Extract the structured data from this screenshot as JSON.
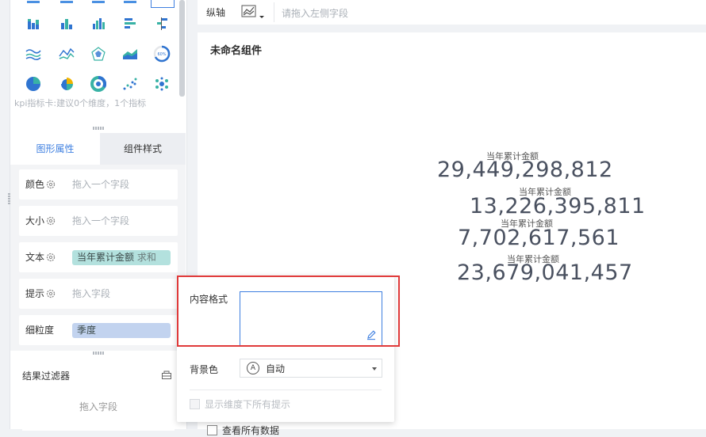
{
  "left_panel": {
    "kpi_hint": "kpi指标卡:建议0个维度，1个指标",
    "tabs": [
      {
        "label": "图形属性",
        "active": true
      },
      {
        "label": "组件样式",
        "active": false
      }
    ],
    "attributes": [
      {
        "label": "颜色",
        "placeholder": "拖入一个字段"
      },
      {
        "label": "大小",
        "placeholder": "拖入一个字段"
      },
      {
        "label": "文本",
        "field": "当年累计金额",
        "agg": "求和",
        "pill_color": "#b3e1de"
      },
      {
        "label": "提示",
        "placeholder": "拖入字段"
      },
      {
        "label": "细粒度",
        "field": "季度",
        "pill_color": "#c2d3ef"
      }
    ],
    "filter": {
      "title": "结果过滤器",
      "placeholder": "拖入字段"
    }
  },
  "topbar": {
    "y_axis_label": "纵轴",
    "y_axis_placeholder": "请拖入左侧字段"
  },
  "canvas": {
    "title": "未命名组件",
    "kpis": [
      {
        "caption": "当年累计金额",
        "value": "29,449,298,812"
      },
      {
        "caption": "当年累计金额",
        "value": "13,226,395,811"
      },
      {
        "caption": "当年累计金额",
        "value": "7,702,617,561"
      },
      {
        "caption": "当年累计金额",
        "value": "23,679,041,457"
      }
    ],
    "view_all_label": "查看所有数据"
  },
  "popup": {
    "content_format_label": "内容格式",
    "content_format_value": "",
    "bg_color_label": "背景色",
    "bg_color_value": "自动",
    "show_tips_label": "显示维度下所有提示"
  },
  "colors": {
    "accent": "#3e7fe0",
    "highlight": "#e03a3a",
    "kpi_text": "#4a5160"
  }
}
